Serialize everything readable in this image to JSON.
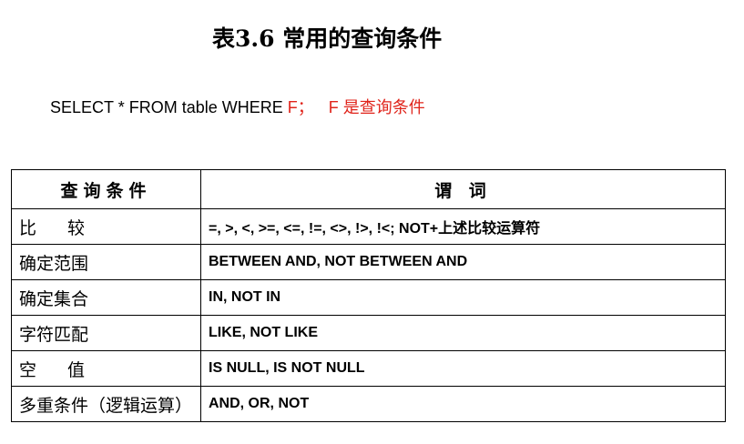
{
  "title": "表3.6 常用的查询条件",
  "sql": {
    "statement": "SELECT * FROM  table  WHERE ",
    "condition_var": "F；",
    "note": "F 是查询条件"
  },
  "table": {
    "headers": [
      "查询条件",
      "谓  词"
    ],
    "rows": [
      {
        "condition": "比  较",
        "predicate": "=, >, <, >=, <=, !=, <>, !>, !<; NOT+上述比较运算符"
      },
      {
        "condition": "确定范围",
        "predicate": "BETWEEN AND, NOT BETWEEN AND"
      },
      {
        "condition": "确定集合",
        "predicate": "IN, NOT IN"
      },
      {
        "condition": "字符匹配",
        "predicate": "LIKE, NOT LIKE"
      },
      {
        "condition": "空  值",
        "predicate": "IS NULL, IS NOT NULL"
      },
      {
        "condition": "多重条件（逻辑运算）",
        "predicate": "AND, OR, NOT"
      }
    ]
  },
  "colors": {
    "accent_red": "#e0241b",
    "text": "#000000"
  }
}
